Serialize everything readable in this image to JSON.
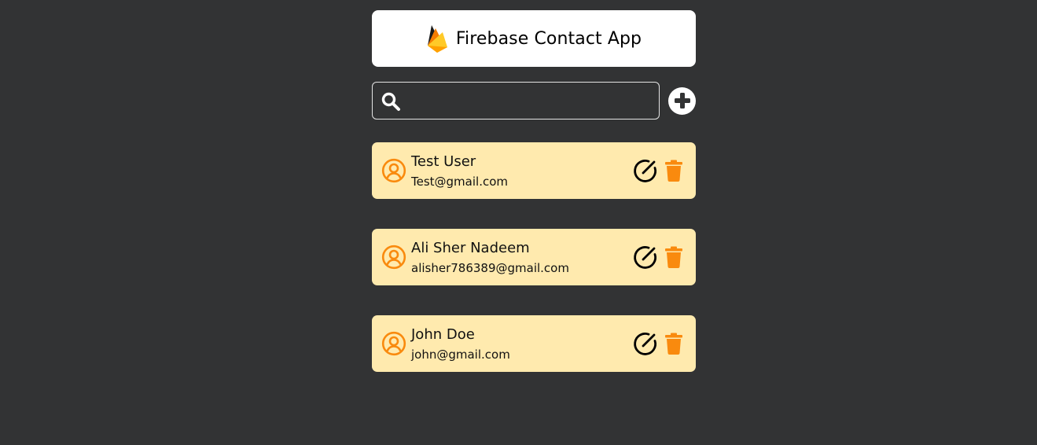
{
  "header": {
    "title": "Firebase Contact App",
    "logo_icon": "firebase-logo-icon"
  },
  "search": {
    "icon": "search-icon",
    "value": "",
    "placeholder": ""
  },
  "add_button": {
    "icon": "plus-circle-icon"
  },
  "contacts": [
    {
      "name": "Test User",
      "email": "Test@gmail.com"
    },
    {
      "name": "Ali Sher Nadeem",
      "email": "alisher786389@gmail.com"
    },
    {
      "name": "John Doe",
      "email": "john@gmail.com"
    }
  ],
  "colors": {
    "background": "#323334",
    "card": "#ffeaae",
    "accent_orange": "#f98a0e",
    "header_bg": "#ffffff"
  }
}
